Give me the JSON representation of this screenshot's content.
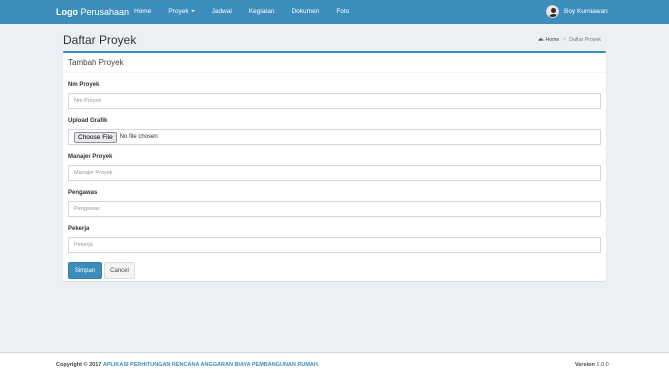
{
  "navbar": {
    "brand_bold": "Logo",
    "brand_rest": " Perusahaan",
    "items": [
      {
        "label": "Home"
      },
      {
        "label": "Proyek"
      },
      {
        "label": "Jadwal"
      },
      {
        "label": "Kegiatan"
      },
      {
        "label": "Dokumen"
      },
      {
        "label": "Foto"
      }
    ],
    "user_name": "Boy Kurniawan",
    "color": "#3c8dbc"
  },
  "header": {
    "title": "Daftar Proyek",
    "breadcrumb": [
      "Home",
      "Daftar Proyek"
    ]
  },
  "box": {
    "title": "Tambah Proyek"
  },
  "form": {
    "nm_proyek": {
      "label": "Nm Proyek",
      "placeholder": "Nm Proyek",
      "value": ""
    },
    "upload_grafik": {
      "label": "Upload Grafik",
      "button_label": "Choose File",
      "status": "No file chosen"
    },
    "manajer_proyek": {
      "label": "Manajer Proyek",
      "placeholder": "Manajer Proyek",
      "value": ""
    },
    "pengawas": {
      "label": "Pengawas",
      "placeholder": "Pengawas",
      "value": ""
    },
    "pekerja": {
      "label": "Pekerja",
      "placeholder": "Pekerja",
      "value": ""
    },
    "submit_label": "Simpan",
    "cancel_label": "Cancel"
  },
  "footer": {
    "copyright_prefix": "Copyright © 2017",
    "app_name": "APLIKASI PERHITUNGAN RENCANA ANGGARAN BIAYA PEMBANGUNAN RUMAH.",
    "version_label": "Version",
    "version_value": "1.0.0"
  },
  "colors": {
    "accent": "#3c8dbc",
    "background": "#ecf0f5"
  }
}
